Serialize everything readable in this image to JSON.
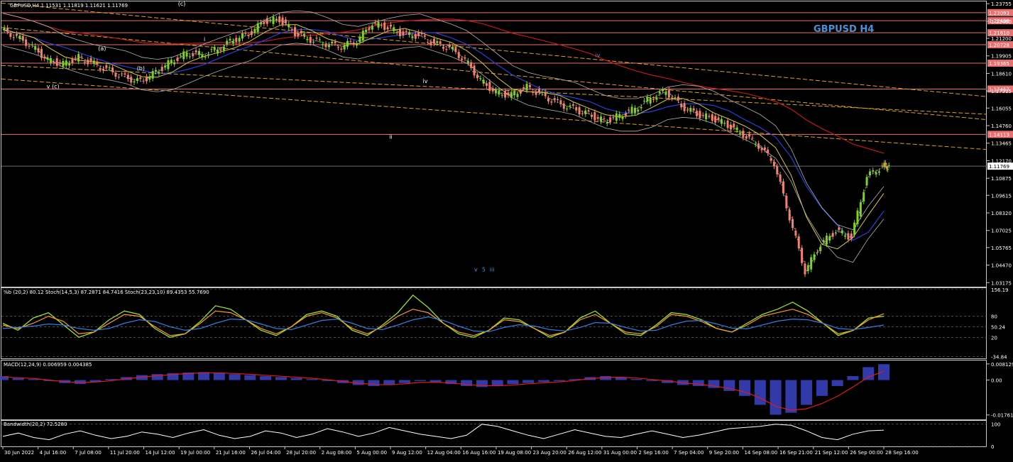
{
  "chart_data": {
    "type": "line",
    "symbol_label": "GBPUSD H4",
    "main_header": "GBPUSD,H4  1.11531 1.11819 1.11621 1.11769",
    "current_price": "1.11769",
    "price_axis": {
      "range": [
        1.0298,
        1.2387
      ],
      "ticks": [
        "1.23755",
        "1.22460",
        "1.21200",
        "1.19905",
        "1.18610",
        "1.17315",
        "1.16055",
        "1.14760",
        "1.13465",
        "1.12170",
        "1.10875",
        "1.09615",
        "1.08320",
        "1.07025",
        "1.05765",
        "1.04470",
        "1.03175"
      ],
      "tick_values": [
        1.23755,
        1.2246,
        1.212,
        1.19905,
        1.1861,
        1.17315,
        1.16055,
        1.1476,
        1.13465,
        1.1217,
        1.10875,
        1.09615,
        1.0832,
        1.07025,
        1.05765,
        1.0447,
        1.03175
      ]
    },
    "levels": [
      {
        "label": "1.23093",
        "value": 1.23093
      },
      {
        "label": "1.22499",
        "value": 1.22499
      },
      {
        "label": "1.21610",
        "value": 1.2161
      },
      {
        "label": "1.20728",
        "value": 1.20728
      },
      {
        "label": "1.19365",
        "value": 1.19365
      },
      {
        "label": "1.17457",
        "value": 1.17457
      },
      {
        "label": "1.14113",
        "value": 1.14113
      }
    ],
    "time_axis": [
      "30 Jun 2022",
      "4 Jul 16:00",
      "7 Jul 08:00",
      "11 Jul 20:00",
      "14 Jul 12:00",
      "19 Jul 00:00",
      "21 Jul 16:00",
      "26 Jul 04:00",
      "28 Jul 20:00",
      "2 Aug 08:00",
      "5 Aug 00:00",
      "9 Aug 12:00",
      "12 Aug 04:00",
      "16 Aug 16:00",
      "19 Aug 08:00",
      "23 Aug 20:00",
      "26 Aug 12:00",
      "31 Aug 00:00",
      "2 Sep 16:00",
      "7 Sep 04:00",
      "9 Sep 20:00",
      "14 Sep 08:00",
      "16 Sep 21:00",
      "21 Sep 12:00",
      "26 Sep 00:00",
      "28 Sep 16:00"
    ],
    "price_series": {
      "name": "GBPUSD",
      "x": [
        0,
        6,
        12,
        18,
        24,
        30,
        36,
        42,
        48,
        54,
        60,
        66,
        72,
        78,
        84,
        90,
        96,
        102,
        108,
        114,
        120,
        126,
        132,
        138,
        144,
        150,
        156,
        162,
        168,
        174,
        180,
        186,
        192,
        198,
        204,
        210,
        216,
        222,
        228,
        234,
        240,
        246,
        252,
        258,
        264,
        270,
        276,
        282,
        288,
        294,
        300,
        306,
        312,
        318,
        324,
        330,
        336,
        342
      ],
      "y": [
        1.2185,
        1.213,
        1.206,
        1.196,
        1.193,
        1.198,
        1.193,
        1.188,
        1.183,
        1.18,
        1.187,
        1.195,
        1.201,
        1.2,
        1.204,
        1.211,
        1.215,
        1.2245,
        1.226,
        1.216,
        1.211,
        1.208,
        1.206,
        1.21,
        1.223,
        1.22,
        1.215,
        1.214,
        1.208,
        1.205,
        1.196,
        1.181,
        1.172,
        1.17,
        1.176,
        1.17,
        1.164,
        1.16,
        1.156,
        1.151,
        1.155,
        1.16,
        1.168,
        1.173,
        1.162,
        1.156,
        1.153,
        1.148,
        1.141,
        1.133,
        1.12,
        1.08,
        1.04,
        1.06,
        1.07,
        1.065,
        1.11,
        1.1177
      ]
    },
    "annotations": [
      {
        "text": "(c)",
        "x": 68,
        "y": 1.236
      },
      {
        "text": "(a)",
        "x": 37,
        "y": 1.203
      },
      {
        "text": "(b)",
        "x": 52,
        "y": 1.1885
      },
      {
        "text": "v (c)",
        "x": 17,
        "y": 1.175
      },
      {
        "text": "i",
        "x": 78,
        "y": 1.21
      },
      {
        "text": "ii",
        "x": 150,
        "y": 1.138
      },
      {
        "text": "iv",
        "x": 163,
        "y": 1.179
      },
      {
        "text": "iv",
        "x": 230,
        "y": 1.198
      },
      {
        "text": "v",
        "x": 183,
        "y": 1.04
      },
      {
        "text": "5",
        "x": 186,
        "y": 1.04
      },
      {
        "text": "iii",
        "x": 189,
        "y": 1.04
      }
    ],
    "stoch_panel": {
      "header": "%b (20,2) 80.12  Stoch(14,5,3) 87.2871 84.7416  Stoch(23,23,10) 89.4353 55.7690",
      "range": [
        -40,
        160
      ],
      "ticks": [
        "156.19",
        "80",
        "50.24",
        "20",
        "-34.84"
      ],
      "tick_values": [
        156.19,
        80,
        50.24,
        20,
        -34.84
      ],
      "series": [
        {
          "name": "%b",
          "values": [
            60,
            40,
            75,
            90,
            55,
            20,
            35,
            70,
            95,
            85,
            45,
            20,
            30,
            65,
            110,
            100,
            70,
            40,
            25,
            50,
            85,
            95,
            80,
            40,
            25,
            55,
            90,
            140,
            105,
            60,
            30,
            20,
            40,
            75,
            70,
            45,
            20,
            35,
            75,
            95,
            60,
            30,
            25,
            55,
            90,
            85,
            70,
            45,
            35,
            60,
            85,
            100,
            120,
            95,
            60,
            25,
            40,
            75,
            80
          ]
        },
        {
          "name": "Stoch(14,5,3)",
          "values": [
            55,
            45,
            60,
            80,
            65,
            30,
            35,
            60,
            85,
            80,
            50,
            25,
            30,
            60,
            95,
            90,
            70,
            45,
            30,
            50,
            80,
            90,
            75,
            45,
            30,
            50,
            80,
            100,
            90,
            60,
            35,
            25,
            40,
            70,
            65,
            45,
            25,
            35,
            70,
            85,
            60,
            35,
            30,
            50,
            85,
            80,
            65,
            45,
            35,
            55,
            80,
            90,
            100,
            85,
            60,
            30,
            40,
            70,
            87
          ]
        },
        {
          "name": "Stoch(23,23,10)",
          "values": [
            45,
            48,
            52,
            58,
            55,
            45,
            40,
            45,
            60,
            70,
            65,
            50,
            40,
            45,
            60,
            72,
            70,
            58,
            45,
            42,
            55,
            68,
            72,
            60,
            45,
            42,
            55,
            70,
            78,
            68,
            52,
            38,
            36,
            48,
            56,
            52,
            42,
            38,
            48,
            62,
            60,
            48,
            38,
            40,
            55,
            66,
            68,
            58,
            46,
            44,
            55,
            66,
            72,
            70,
            60,
            45,
            42,
            48,
            55
          ]
        }
      ]
    },
    "macd_panel": {
      "header": "MACD(12,24,9) 0.006959 0.004385",
      "range": [
        -0.0195,
        0.0095
      ],
      "ticks": [
        "0.008129",
        "0.00",
        "-0.01761"
      ],
      "tick_values": [
        0.008129,
        0,
        -0.01761
      ],
      "histogram": [
        0.002,
        0.001,
        0.0005,
        -0.0005,
        -0.0015,
        -0.002,
        -0.001,
        0.0005,
        0.0015,
        0.0025,
        0.003,
        0.0035,
        0.0038,
        0.004,
        0.0035,
        0.003,
        0.0025,
        0.002,
        0.0015,
        0.001,
        0.0005,
        -0.0005,
        -0.0015,
        -0.0025,
        -0.003,
        -0.0025,
        -0.0015,
        -0.0005,
        -0.001,
        -0.002,
        -0.003,
        -0.0035,
        -0.003,
        -0.002,
        -0.0015,
        -0.001,
        -0.0005,
        0.0005,
        0.0015,
        0.002,
        0.0015,
        0.0005,
        -0.0005,
        -0.0015,
        -0.0025,
        -0.003,
        -0.004,
        -0.0055,
        -0.008,
        -0.0125,
        -0.0175,
        -0.0165,
        -0.0125,
        -0.008,
        -0.003,
        0.002,
        0.0065,
        0.008
      ],
      "signal": [
        0.0015,
        0.0012,
        0.0008,
        0.0,
        -0.0008,
        -0.0012,
        -0.001,
        -0.0003,
        0.0006,
        0.0015,
        0.0022,
        0.0028,
        0.0033,
        0.0036,
        0.0036,
        0.0033,
        0.0029,
        0.0024,
        0.0019,
        0.0014,
        0.0009,
        0.0002,
        -0.0007,
        -0.0016,
        -0.0022,
        -0.0024,
        -0.0019,
        -0.0012,
        -0.0011,
        -0.0015,
        -0.0022,
        -0.0028,
        -0.0029,
        -0.0025,
        -0.0019,
        -0.0014,
        -0.0009,
        -0.0002,
        0.0007,
        0.0013,
        0.0014,
        0.001,
        0.0003,
        -0.0005,
        -0.0014,
        -0.0021,
        -0.003,
        -0.0042,
        -0.006,
        -0.009,
        -0.0132,
        -0.0152,
        -0.0145,
        -0.0118,
        -0.0082,
        -0.0035,
        0.0015,
        0.0044
      ]
    },
    "bandwidth_panel": {
      "header": "Bandwidth(20,2) 72.5280",
      "range": [
        0,
        115
      ],
      "ticks": [
        "100",
        "0"
      ],
      "tick_values": [
        100,
        0
      ],
      "values": [
        45,
        60,
        40,
        30,
        55,
        70,
        50,
        35,
        45,
        65,
        55,
        40,
        60,
        75,
        50,
        35,
        45,
        70,
        60,
        40,
        55,
        80,
        65,
        45,
        60,
        85,
        70,
        55,
        45,
        35,
        50,
        100,
        90,
        70,
        50,
        35,
        55,
        75,
        60,
        45,
        40,
        55,
        70,
        55,
        40,
        50,
        65,
        80,
        85,
        90,
        100,
        95,
        70,
        40,
        30,
        55,
        70,
        73
      ]
    }
  }
}
